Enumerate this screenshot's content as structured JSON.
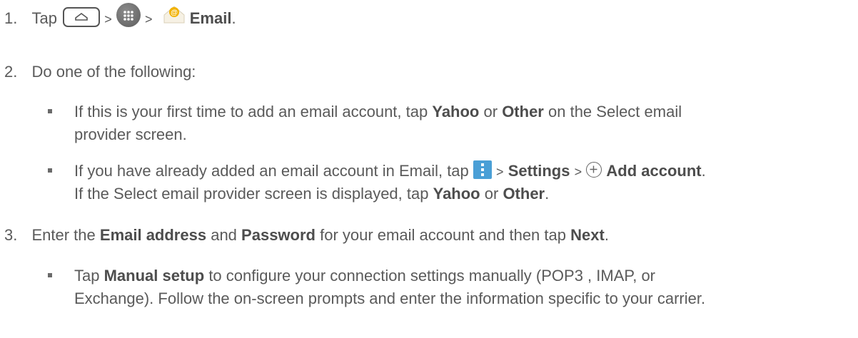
{
  "steps": [
    {
      "num": "1.",
      "tap": "Tap",
      "sep": ">",
      "email": "Email",
      "end": "."
    },
    {
      "num": "2.",
      "text": "Do one of the following:"
    },
    {
      "num": "3.",
      "t1": "Enter the",
      "email_address": "Email address",
      "t2": "and",
      "password": "Password",
      "t3": "for your email account and then tap",
      "next": "Next",
      "end": "."
    }
  ],
  "bullet1": {
    "l1_a": "If this is your first time to add an email account, tap",
    "yahoo": "Yahoo",
    "or": "or",
    "other": "Other",
    "l1_b": "on the Select email",
    "l2": "provider screen."
  },
  "bullet2": {
    "l1_a": "If you have already added an email account in Email, tap",
    "sep": ">",
    "settings": "Settings",
    "add_account": "Add account",
    "end": ".",
    "l2_a": "If the Select email provider screen is displayed, tap",
    "yahoo": "Yahoo",
    "or": "or",
    "other": "Other"
  },
  "bullet3": {
    "tap": "Tap",
    "manual": "Manual setup",
    "l1_b": "to configure your connection settings manually (POP3 , IMAP, or",
    "l2": "Exchange). Follow the on-screen prompts and enter the information specific to your carrier."
  },
  "icons": {
    "home": "home-icon",
    "apps": "apps-icon",
    "email": "email-icon",
    "menu": "menu-icon",
    "plus": "plus-icon"
  },
  "colors": {
    "menu_icon": "#4a9fd6",
    "email_icon": "#f2b200"
  }
}
